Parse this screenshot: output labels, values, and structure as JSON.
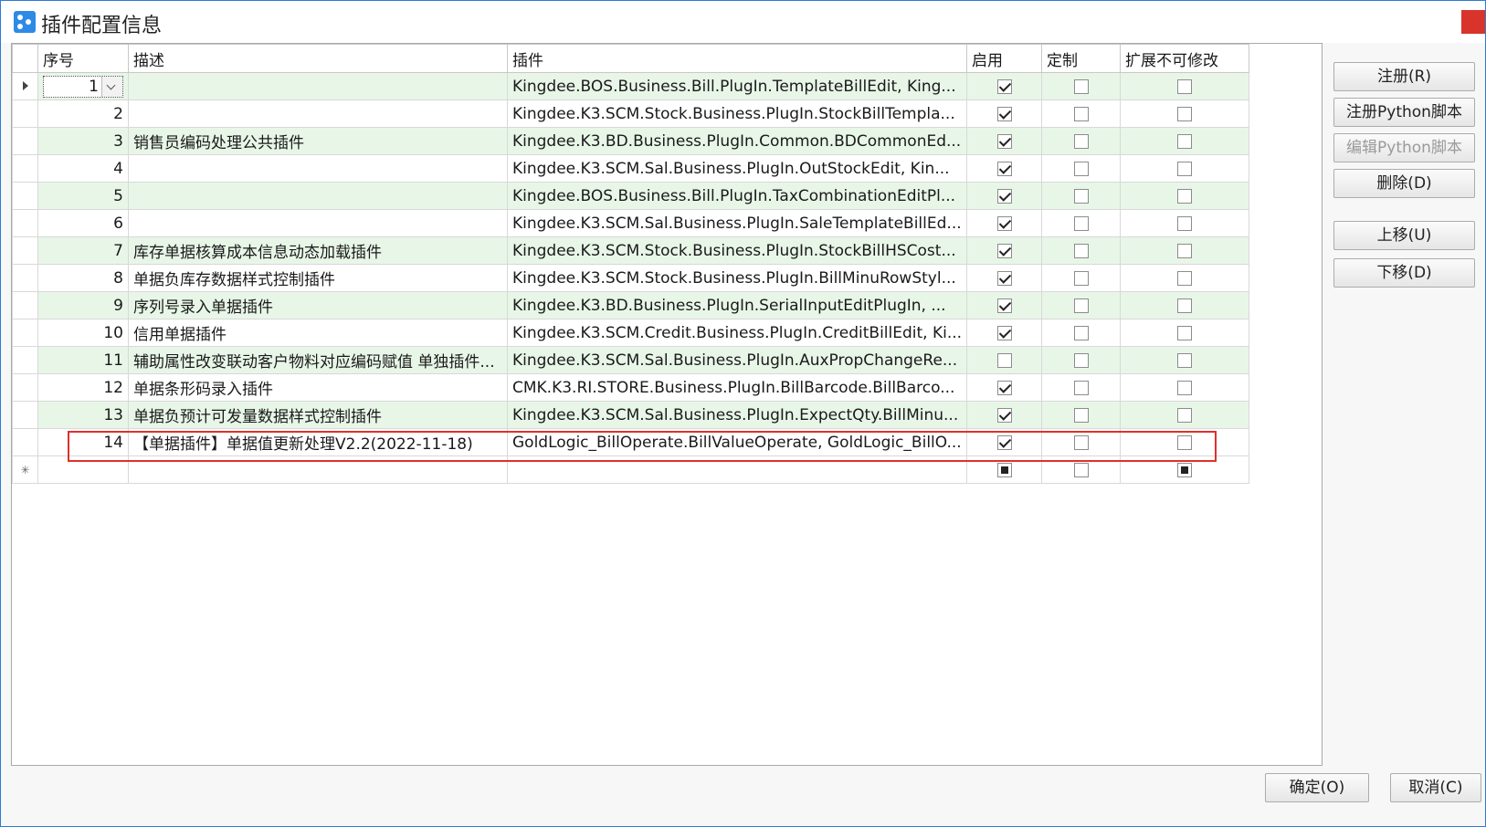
{
  "window": {
    "title": "插件配置信息"
  },
  "columns": {
    "seq": "序号",
    "desc": "描述",
    "plugin": "插件",
    "enabled": "启用",
    "custom": "定制",
    "ext_lock": "扩展不可修改"
  },
  "rows": [
    {
      "seq": "1",
      "desc": "",
      "plugin": "Kingdee.BOS.Business.Bill.PlugIn.TemplateBillEdit, King...",
      "enabled": true,
      "custom": false,
      "ext_lock": false
    },
    {
      "seq": "2",
      "desc": "",
      "plugin": "Kingdee.K3.SCM.Stock.Business.PlugIn.StockBillTempla...",
      "enabled": true,
      "custom": false,
      "ext_lock": false
    },
    {
      "seq": "3",
      "desc": "销售员编码处理公共插件",
      "plugin": "Kingdee.K3.BD.Business.PlugIn.Common.BDCommonEd...",
      "enabled": true,
      "custom": false,
      "ext_lock": false
    },
    {
      "seq": "4",
      "desc": "",
      "plugin": "Kingdee.K3.SCM.Sal.Business.PlugIn.OutStockEdit, Kin...",
      "enabled": true,
      "custom": false,
      "ext_lock": false
    },
    {
      "seq": "5",
      "desc": "",
      "plugin": "Kingdee.BOS.Business.Bill.PlugIn.TaxCombinationEditPl...",
      "enabled": true,
      "custom": false,
      "ext_lock": false
    },
    {
      "seq": "6",
      "desc": "",
      "plugin": "Kingdee.K3.SCM.Sal.Business.PlugIn.SaleTemplateBillEd...",
      "enabled": true,
      "custom": false,
      "ext_lock": false
    },
    {
      "seq": "7",
      "desc": "库存单据核算成本信息动态加载插件",
      "plugin": "Kingdee.K3.SCM.Stock.Business.PlugIn.StockBillHSCost...",
      "enabled": true,
      "custom": false,
      "ext_lock": false
    },
    {
      "seq": "8",
      "desc": "单据负库存数据样式控制插件",
      "plugin": "Kingdee.K3.SCM.Stock.Business.PlugIn.BillMinuRowStyl...",
      "enabled": true,
      "custom": false,
      "ext_lock": false
    },
    {
      "seq": "9",
      "desc": "序列号录入单据插件",
      "plugin": "Kingdee.K3.BD.Business.PlugIn.SerialInputEditPlugIn, ...",
      "enabled": true,
      "custom": false,
      "ext_lock": false
    },
    {
      "seq": "10",
      "desc": "信用单据插件",
      "plugin": "Kingdee.K3.SCM.Credit.Business.PlugIn.CreditBillEdit, Ki...",
      "enabled": true,
      "custom": false,
      "ext_lock": false
    },
    {
      "seq": "11",
      "desc": "辅助属性改变联动客户物料对应编码赋值 单独插件...",
      "plugin": "Kingdee.K3.SCM.Sal.Business.PlugIn.AuxPropChangeRe...",
      "enabled": false,
      "custom": false,
      "ext_lock": false
    },
    {
      "seq": "12",
      "desc": "单据条形码录入插件",
      "plugin": "CMK.K3.RI.STORE.Business.PlugIn.BillBarcode.BillBarco...",
      "enabled": true,
      "custom": false,
      "ext_lock": false
    },
    {
      "seq": "13",
      "desc": "单据负预计可发量数据样式控制插件",
      "plugin": "Kingdee.K3.SCM.Sal.Business.PlugIn.ExpectQty.BillMinu...",
      "enabled": true,
      "custom": false,
      "ext_lock": false
    },
    {
      "seq": "14",
      "desc": "【单据插件】单据值更新处理V2.2(2022-11-18)",
      "plugin": "GoldLogic_BillOperate.BillValueOperate, GoldLogic_BillO...",
      "enabled": true,
      "custom": false,
      "ext_lock": false
    }
  ],
  "side_buttons": {
    "register": "注册(R)",
    "register_python": "注册Python脚本",
    "edit_python": "编辑Python脚本",
    "delete": "删除(D)",
    "move_up": "上移(U)",
    "move_down": "下移(D)"
  },
  "footer": {
    "ok": "确定(O)",
    "cancel": "取消(C)"
  },
  "colors": {
    "row_alt": "#e8f6e8",
    "highlight": "#e0302c",
    "accent": "#2d8ae6"
  }
}
